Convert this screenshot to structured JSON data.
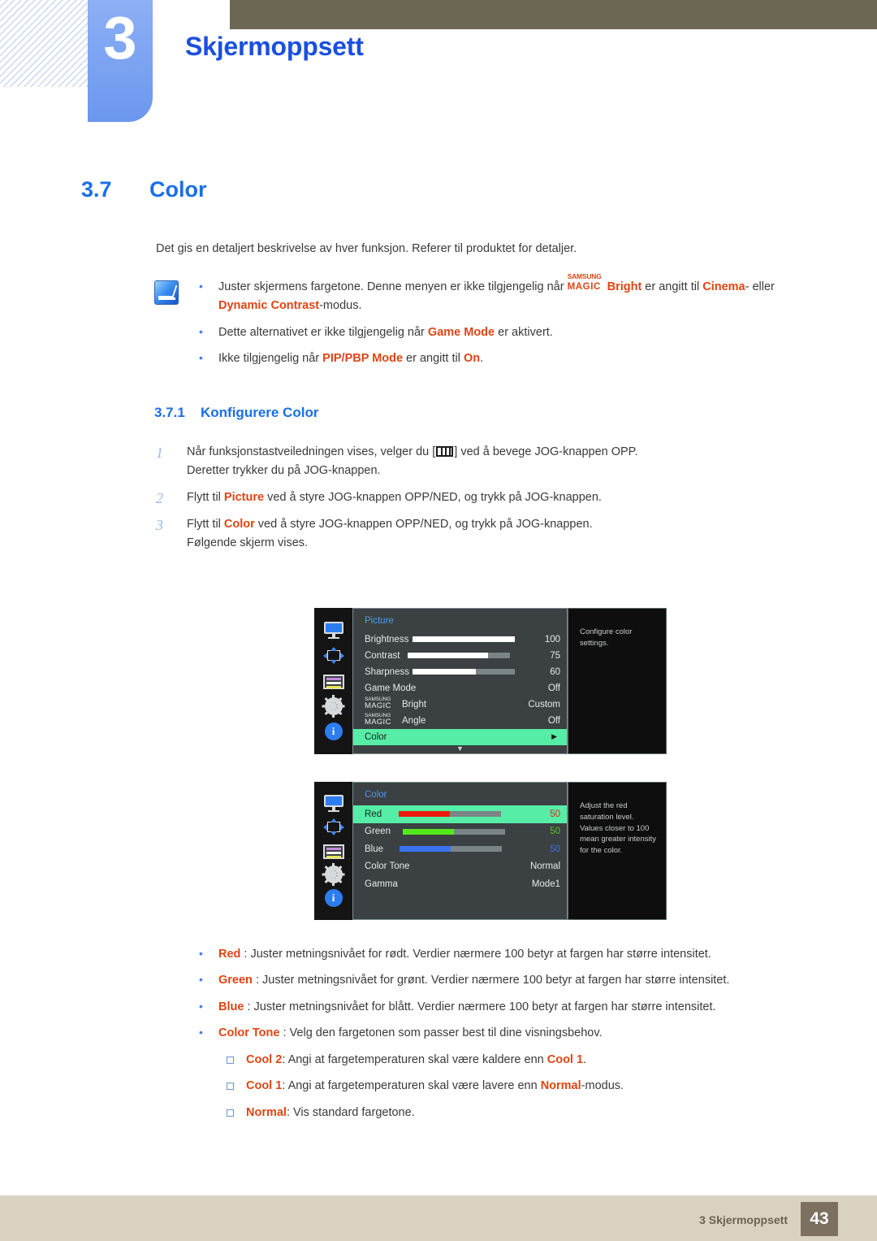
{
  "chapter": {
    "number": "3",
    "title": "Skjermoppsett"
  },
  "section": {
    "number": "3.7",
    "title": "Color"
  },
  "lead": "Det gis en detaljert beskrivelse av hver funksjon. Referer til produktet for detaljer.",
  "notes": {
    "icon": "note-pencil-icon",
    "items": [
      {
        "parts": [
          {
            "t": "Juster skjermens fargetone. Denne menyen er ikke tilgjengelig når ",
            "s": "n"
          },
          {
            "t": "SAMSUNG|MAGIC",
            "s": "smagic"
          },
          {
            "t": "Bright",
            "s": "r"
          },
          {
            "t": " er angitt til ",
            "s": "n"
          },
          {
            "t": "Cinema",
            "s": "r"
          },
          {
            "t": "- eller ",
            "s": "n"
          },
          {
            "t": "Dynamic Contrast",
            "s": "r"
          },
          {
            "t": "-modus.",
            "s": "n"
          }
        ]
      },
      {
        "parts": [
          {
            "t": "Dette alternativet er ikke tilgjengelig når ",
            "s": "n"
          },
          {
            "t": "Game Mode",
            "s": "r"
          },
          {
            "t": " er aktivert.",
            "s": "n"
          }
        ]
      },
      {
        "parts": [
          {
            "t": "Ikke tilgjengelig når ",
            "s": "n"
          },
          {
            "t": "PIP/PBP Mode",
            "s": "r"
          },
          {
            "t": " er angitt til ",
            "s": "n"
          },
          {
            "t": "On",
            "s": "r"
          },
          {
            "t": ".",
            "s": "n"
          }
        ]
      }
    ]
  },
  "subsection": {
    "number": "3.7.1",
    "title": "Konfigurere Color"
  },
  "steps": [
    {
      "num": "1",
      "parts": [
        {
          "t": "Når funksjonstastveiledningen vises, velger du [",
          "s": "n"
        },
        {
          "t": "jog-menu-key",
          "s": "jog"
        },
        {
          "t": "] ved å bevege JOG-knappen OPP.",
          "s": "n"
        },
        {
          "t": "\nDeretter trykker du på JOG-knappen.",
          "s": "n"
        }
      ]
    },
    {
      "num": "2",
      "parts": [
        {
          "t": "Flytt til ",
          "s": "n"
        },
        {
          "t": "Picture",
          "s": "r"
        },
        {
          "t": " ved å styre JOG-knappen OPP/NED, og trykk på JOG-knappen.",
          "s": "n"
        }
      ]
    },
    {
      "num": "3",
      "parts": [
        {
          "t": "Flytt til ",
          "s": "n"
        },
        {
          "t": "Color",
          "s": "r"
        },
        {
          "t": " ved å styre JOG-knappen OPP/NED, og trykk på JOG-knappen.",
          "s": "n"
        },
        {
          "t": "\nFølgende skjerm vises.",
          "s": "n"
        }
      ]
    }
  ],
  "osd_picture": {
    "title": "Picture",
    "rail_icons": [
      "monitor-icon",
      "arrows-icon",
      "osd-list-icon",
      "gear-icon",
      "info-icon"
    ],
    "rows": [
      {
        "label": "Brightness",
        "value": "100",
        "bar": 100,
        "bar_color": "#ffffff",
        "type": "slider"
      },
      {
        "label": "Contrast",
        "value": "75",
        "bar": 78,
        "bar_color": "#ffffff",
        "type": "slider"
      },
      {
        "label": "Sharpness",
        "value": "60",
        "bar": 62,
        "bar_color": "#ffffff",
        "type": "slider"
      },
      {
        "label": "Game Mode",
        "value": "Off",
        "type": "text"
      },
      {
        "label": "SAMSUNG|MAGIC|Bright",
        "value": "Custom",
        "type": "magic"
      },
      {
        "label": "SAMSUNG|MAGIC|Angle",
        "value": "Off",
        "type": "magic"
      },
      {
        "label": "Color",
        "value": "",
        "type": "highlight",
        "caret": "▶"
      }
    ],
    "scroll_hint": "▼",
    "description": "Configure color settings."
  },
  "osd_color": {
    "title": "Color",
    "rail_icons": [
      "monitor-icon",
      "arrows-icon",
      "osd-list-icon",
      "gear-icon",
      "info-icon"
    ],
    "rows": [
      {
        "label": "Red",
        "value": "50",
        "bar": 50,
        "bar_color": "#ec1c0c",
        "value_color": "#e8240e",
        "type": "slider",
        "highlight": true
      },
      {
        "label": "Green",
        "value": "50",
        "bar": 50,
        "bar_color": "#54e81c",
        "value_color": "#54c81c",
        "type": "slider"
      },
      {
        "label": "Blue",
        "value": "50",
        "bar": 50,
        "bar_color": "#3a72ee",
        "value_color": "#3a72ee",
        "type": "slider"
      },
      {
        "label": "Color Tone",
        "value": "Normal",
        "type": "text"
      },
      {
        "label": "Gamma",
        "value": "Mode1",
        "type": "text"
      }
    ],
    "description": "Adjust the red saturation level. Values closer to 100 mean greater intensity for the color."
  },
  "bottom_bullets": [
    {
      "level": 1,
      "parts": [
        {
          "t": "Red",
          "s": "r"
        },
        {
          "t": " : Juster metningsnivået for rødt. Verdier nærmere 100 betyr at fargen har større intensitet.",
          "s": "n"
        }
      ]
    },
    {
      "level": 1,
      "parts": [
        {
          "t": "Green",
          "s": "r"
        },
        {
          "t": " : Juster metningsnivået for grønt. Verdier nærmere 100 betyr at fargen har større intensitet.",
          "s": "n"
        }
      ]
    },
    {
      "level": 1,
      "parts": [
        {
          "t": "Blue",
          "s": "r"
        },
        {
          "t": " : Juster metningsnivået for blått. Verdier nærmere 100 betyr at fargen har større intensitet.",
          "s": "n"
        }
      ]
    },
    {
      "level": 1,
      "parts": [
        {
          "t": "Color Tone",
          "s": "r"
        },
        {
          "t": " : Velg den fargetonen som passer best til dine visningsbehov.",
          "s": "n"
        }
      ]
    },
    {
      "level": 2,
      "parts": [
        {
          "t": "Cool 2",
          "s": "r"
        },
        {
          "t": ": Angi at fargetemperaturen skal være kaldere enn ",
          "s": "n"
        },
        {
          "t": "Cool 1",
          "s": "r"
        },
        {
          "t": ".",
          "s": "n"
        }
      ]
    },
    {
      "level": 2,
      "parts": [
        {
          "t": "Cool 1",
          "s": "r"
        },
        {
          "t": ": Angi at fargetemperaturen skal være lavere enn ",
          "s": "n"
        },
        {
          "t": "Normal",
          "s": "r"
        },
        {
          "t": "-modus.",
          "s": "n"
        }
      ]
    },
    {
      "level": 2,
      "parts": [
        {
          "t": "Normal",
          "s": "r"
        },
        {
          "t": ": Vis standard fargetone.",
          "s": "n"
        }
      ]
    }
  ],
  "footer": {
    "label": "3 Skjermoppsett",
    "page": "43"
  }
}
